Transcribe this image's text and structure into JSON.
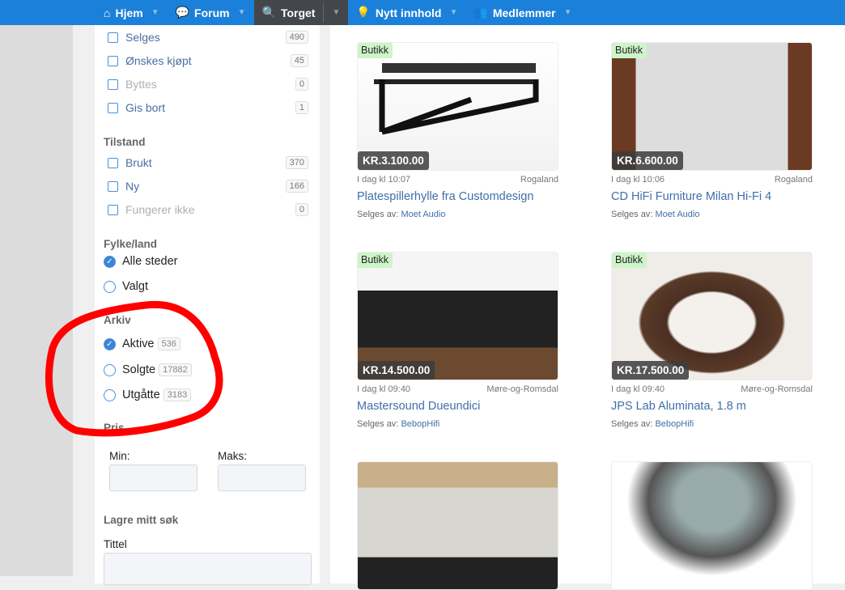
{
  "nav": [
    {
      "label": "Hjem",
      "icon": "home-icon"
    },
    {
      "label": "Forum",
      "icon": "comments-icon"
    },
    {
      "label": "Torget",
      "icon": "search-dollar-icon",
      "active": true
    },
    {
      "label": "Nytt innhold",
      "icon": "lightbulb-icon"
    },
    {
      "label": "Medlemmer",
      "icon": "users-icon"
    }
  ],
  "type_filters": [
    {
      "label": "Selges",
      "count": "490"
    },
    {
      "label": "Ønskes kjøpt",
      "count": "45"
    },
    {
      "label": "Byttes",
      "count": "0",
      "disabled": true
    },
    {
      "label": "Gis bort",
      "count": "1"
    }
  ],
  "tilstand": {
    "heading": "Tilstand",
    "items": [
      {
        "label": "Brukt",
        "count": "370"
      },
      {
        "label": "Ny",
        "count": "166"
      },
      {
        "label": "Fungerer ikke",
        "count": "0",
        "disabled": true
      }
    ]
  },
  "fylke": {
    "heading": "Fylke/land",
    "items": [
      {
        "label": "Alle steder",
        "checked": true
      },
      {
        "label": "Valgt"
      }
    ]
  },
  "arkiv": {
    "heading": "Arkiv",
    "items": [
      {
        "label": "Aktive",
        "count": "536",
        "checked": true
      },
      {
        "label": "Solgte",
        "count": "17882"
      },
      {
        "label": "Utgåtte",
        "count": "3183"
      }
    ]
  },
  "pris": {
    "heading": "Pris",
    "min_label": "Min:",
    "max_label": "Maks:"
  },
  "save": {
    "heading": "Lagre mitt søk",
    "title_label": "Tittel"
  },
  "listings": [
    {
      "badge": "Butikk",
      "price": "KR.3.100.00",
      "time": "I dag kl 10:07",
      "region": "Rogaland",
      "title": "Platespillerhylle fra Customdesign",
      "seller_prefix": "Selges av:",
      "seller": "Moet Audio"
    },
    {
      "badge": "Butikk",
      "price": "KR.6.600.00",
      "time": "I dag kl 10:06",
      "region": "Rogaland",
      "title": "CD HiFi Furniture Milan Hi-Fi 4",
      "seller_prefix": "Selges av:",
      "seller": "Moet Audio"
    },
    {
      "badge": "Butikk",
      "price": "KR.14.500.00",
      "time": "I dag kl 09:40",
      "region": "Møre-og-Romsdal",
      "title": "Mastersound Dueundici",
      "seller_prefix": "Selges av:",
      "seller": "BebopHifi"
    },
    {
      "badge": "Butikk",
      "price": "KR.17.500.00",
      "time": "I dag kl 09:40",
      "region": "Møre-og-Romsdal",
      "title": "JPS Lab Aluminata, 1.8 m",
      "seller_prefix": "Selges av:",
      "seller": "BebopHifi"
    }
  ]
}
